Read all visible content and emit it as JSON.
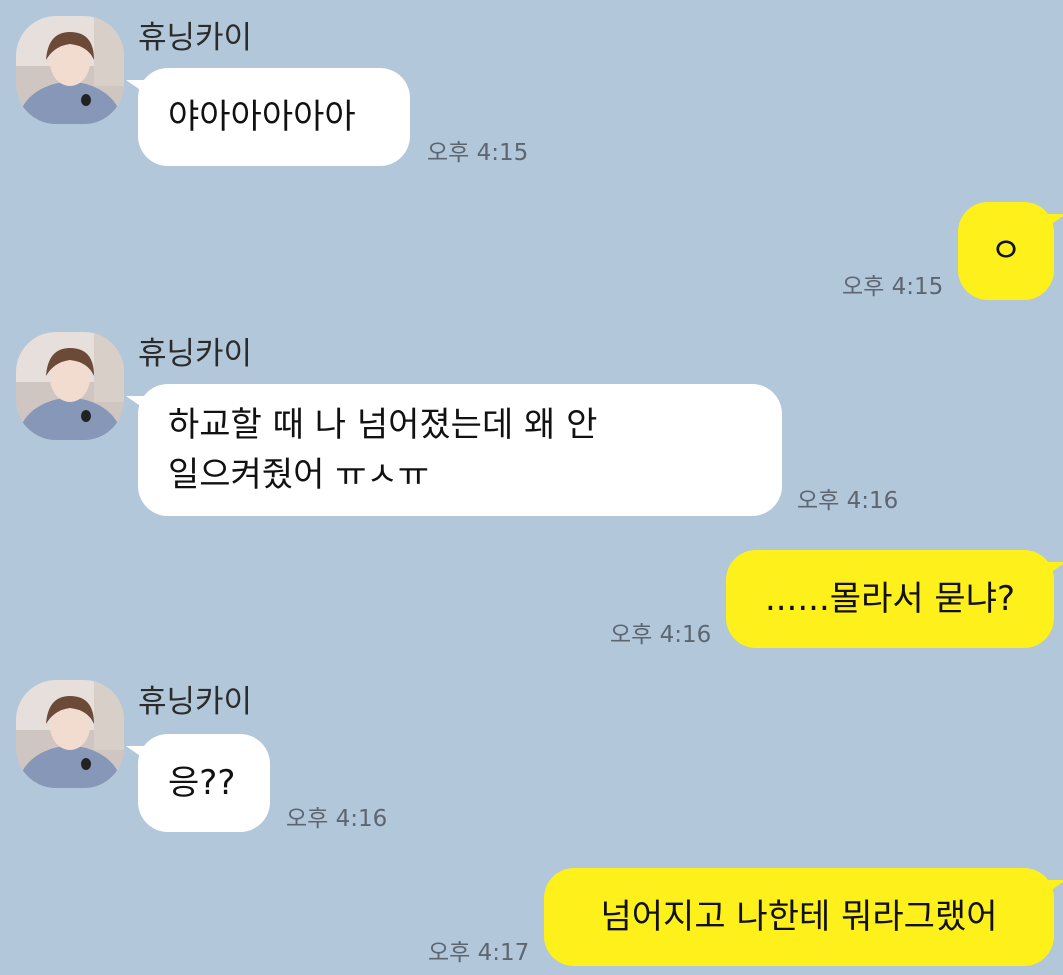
{
  "chat": {
    "messages": [
      {
        "sender": "휴닝카이",
        "direction": "incoming",
        "text": "야아아아아아",
        "time": "오후 4:15"
      },
      {
        "direction": "outgoing",
        "text": "ㅇ",
        "time": "오후 4:15"
      },
      {
        "sender": "휴닝카이",
        "direction": "incoming",
        "lines": [
          "하교할 때 나 넘어졌는데 왜 안",
          "일으켜줬어 ㅠㅅㅠ"
        ],
        "time": "오후 4:16"
      },
      {
        "direction": "outgoing",
        "text": "......몰라서 묻냐?",
        "time": "오후 4:16"
      },
      {
        "sender": "휴닝카이",
        "direction": "incoming",
        "text": "응??",
        "time": "오후 4:16"
      },
      {
        "direction": "outgoing",
        "text": "넘어지고 나한테 뭐라그랬어",
        "time": "오후 4:17"
      }
    ]
  },
  "colors": {
    "background": "#b2c7da",
    "incoming_bubble": "#ffffff",
    "outgoing_bubble": "#fef01b",
    "timestamp": "#5d6670"
  }
}
